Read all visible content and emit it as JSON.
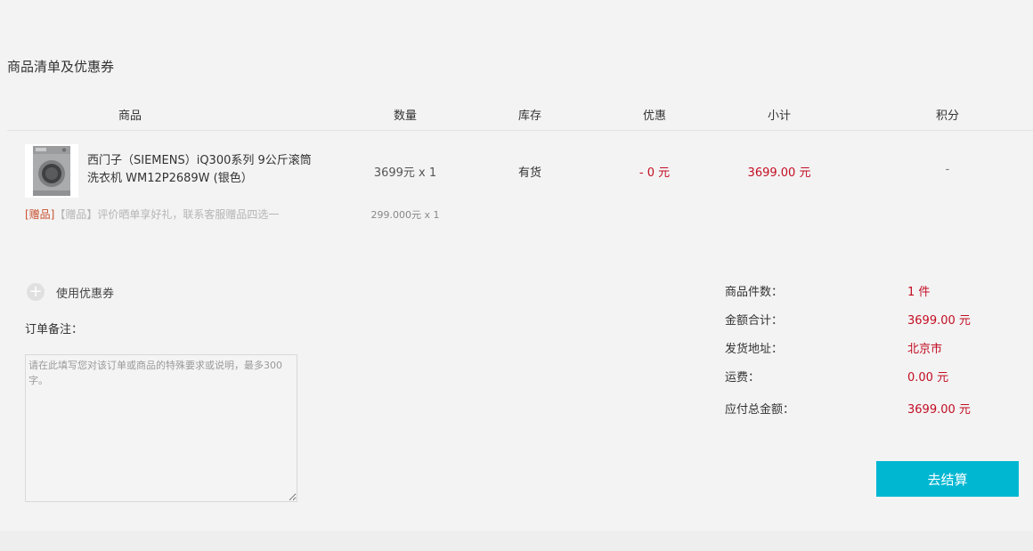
{
  "section": {
    "title": "商品清单及优惠券"
  },
  "table": {
    "headers": [
      "商品",
      "数量",
      "库存",
      "优惠",
      "小计",
      "积分"
    ]
  },
  "product": {
    "name": "西门子（SIEMENS）iQ300系列 9公斤滚筒洗衣机 WM12P2689W (银色）",
    "quantity": "3699元 x 1",
    "stock": "有货",
    "discount": "- 0 元",
    "subtotal": "3699.00 元",
    "points": "-"
  },
  "gift": {
    "tag": "[赠品]",
    "text": "【赠品】评价晒单享好礼，联系客服赠品四选一",
    "price": "299.000元 x 1"
  },
  "coupon": {
    "label": "使用优惠券"
  },
  "remark": {
    "label": "订单备注：",
    "placeholder": "请在此填写您对该订单或商品的特殊要求或说明，最多300字。"
  },
  "summary": {
    "count_label": "商品件数：",
    "count_value": "1 件",
    "amount_label": "金额合计：",
    "amount_value": "3699.00 元",
    "address_label": "发货地址：",
    "address_value": "北京市",
    "shipping_label": "运费：",
    "shipping_value": "0.00 元",
    "total_label": "应付总金额：",
    "total_value": "3699.00 元"
  },
  "checkout": {
    "label": "去结算"
  },
  "colors": {
    "accent": "#00b7d2",
    "price_red": "#c30d23",
    "gift_tag": "#c8502f"
  },
  "icons": {
    "thumb": "washing-machine-image",
    "coupon": "plus-circle-icon"
  }
}
